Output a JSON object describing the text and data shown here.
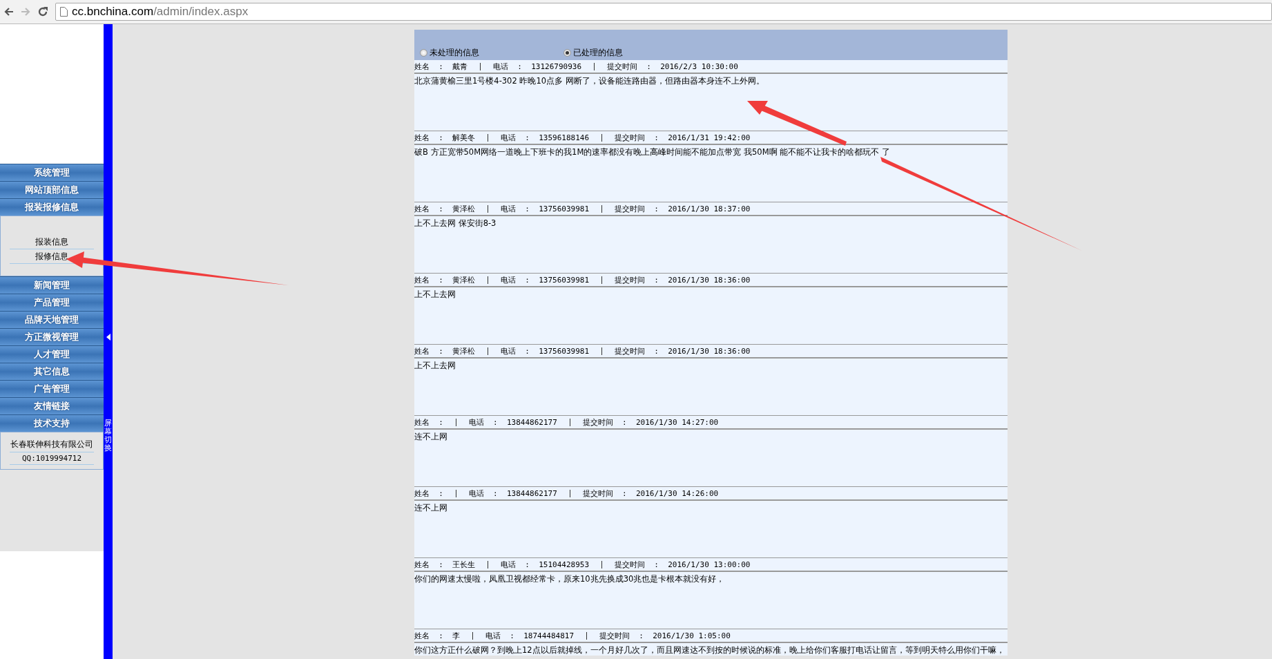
{
  "browser": {
    "url_host": "cc.bnchina.com",
    "url_path": "/admin/index.aspx"
  },
  "sidebar": {
    "menu_top": [
      "系统管理",
      "网站顶部信息",
      "报装报修信息"
    ],
    "submenu": [
      "报装信息",
      "报修信息"
    ],
    "menu_bottom": [
      "新闻管理",
      "产品管理",
      "品牌天地管理",
      "方正微视管理",
      "人才管理",
      "其它信息",
      "广告管理",
      "友情链接",
      "技术支持"
    ],
    "company": "长春联伸科技有限公司",
    "qq": "QQ:1019994712",
    "toggle_label": "屏幕切换"
  },
  "filter": [
    {
      "label": "未处理的信息",
      "selected": false
    },
    {
      "label": "已处理的信息",
      "selected": true
    }
  ],
  "records": [
    {
      "name": "姓名  :  戴青",
      "phone": "电话  :  13126790936",
      "time": "提交时间  :  2016/2/3 10:30:00",
      "message": "北京蒲黄榆三里1号楼4-302 昨晚10点多 网断了，设备能连路由器，但路由器本身连不上外网。"
    },
    {
      "name": "姓名  :  解美冬",
      "phone": "电话  :  13596188146",
      "time": "提交时间  :  2016/1/31 19:42:00",
      "message": "破B 方正宽带50M网络一道晚上下班卡的我1M的速率都没有晚上高峰时间能不能加点带宽 我50M啊 能不能不让我卡的啥都玩不 了"
    },
    {
      "name": "姓名  :  黄泽松",
      "phone": "电话  :  13756039981",
      "time": "提交时间  :  2016/1/30 18:37:00",
      "message": "上不上去网 保安街8-3"
    },
    {
      "name": "姓名  :  黄泽松",
      "phone": "电话  :  13756039981",
      "time": "提交时间  :  2016/1/30 18:36:00",
      "message": "上不上去网"
    },
    {
      "name": "姓名  :  黄泽松",
      "phone": "电话  :  13756039981",
      "time": "提交时间  :  2016/1/30 18:36:00",
      "message": "上不上去网"
    },
    {
      "name": "姓名  :",
      "phone": "电话  :  13844862177",
      "time": "提交时间  :  2016/1/30 14:27:00",
      "message": "连不上网"
    },
    {
      "name": "姓名  :",
      "phone": "电话  :  13844862177",
      "time": "提交时间  :  2016/1/30 14:26:00",
      "message": "连不上网"
    },
    {
      "name": "姓名  :  王长生",
      "phone": "电话  :  15104428953",
      "time": "提交时间  :  2016/1/30 13:00:00",
      "message": "你们的网速太慢啦，凤凰卫视都经常卡，原来10兆先换成30兆也是卡根本就没有好，"
    },
    {
      "name": "姓名  :  李",
      "phone": "电话  :  18744484817",
      "time": "提交时间  :  2016/1/30 1:05:00",
      "message": "你们这方正什么破网？到晚上12点以后就掉线，一个月好几次了，而且网速达不到按的时候说的标准，晚上给你们客服打电话让留言，等到明天特么用你们干嘛，"
    }
  ]
}
